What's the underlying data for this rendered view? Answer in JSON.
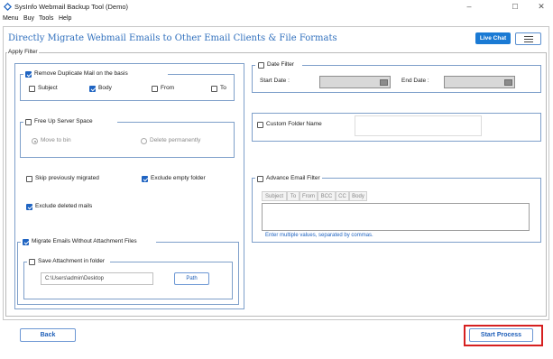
{
  "window": {
    "title": "SysInfo Webmail Backup Tool (Demo)",
    "controls": [
      "–",
      "☐",
      "✕"
    ]
  },
  "menu": [
    "Menu",
    "Buy",
    "Tools",
    "Help"
  ],
  "header": {
    "title": "Directly Migrate Webmail Emails to Other Email Clients & File Formats",
    "live_chat_label": "Live Chat"
  },
  "apply_filter": {
    "legend": "Apply Filter",
    "remove_duplicates": {
      "label": "Remove Duplicate Mail on the basis",
      "checked": true,
      "options": [
        {
          "label": "Subject",
          "checked": false
        },
        {
          "label": "Body",
          "checked": true
        },
        {
          "label": "From",
          "checked": false
        },
        {
          "label": "To",
          "checked": false
        }
      ]
    },
    "free_up": {
      "label": "Free Up Server Space",
      "checked": false,
      "options": [
        {
          "label": "Move to bin",
          "selected": true
        },
        {
          "label": "Delete permanently",
          "selected": false
        }
      ]
    },
    "skip_previously": {
      "label": "Skip previously migrated",
      "checked": false
    },
    "exclude_empty": {
      "label": "Exclude empty folder",
      "checked": true
    },
    "exclude_deleted": {
      "label": "Exclude deleted mails",
      "checked": true
    },
    "migrate_without_attachment": {
      "label": "Migrate Emails Without Attachment Files",
      "checked": true
    },
    "save_attachment": {
      "label": "Save Attachment in folder",
      "checked": false,
      "path_value": "C:\\Users\\admin\\Desktop",
      "path_button": "Path"
    },
    "date_filter": {
      "label": "Date Filter",
      "checked": false,
      "start_label": "Start Date :",
      "end_label": "End Date :"
    },
    "custom_folder": {
      "label": "Custom Folder Name",
      "checked": false,
      "value": ""
    },
    "advance_filter": {
      "label": "Advance Email Filter",
      "checked": false,
      "tabs": [
        "Subject",
        "To",
        "From",
        "BCC",
        "CC",
        "Body"
      ],
      "hint": "Enter multiple values, separated by commas."
    }
  },
  "footer": {
    "back_label": "Back",
    "start_label": "Start Process"
  },
  "colors": {
    "accent": "#1f64c2",
    "title_blue": "#2f6fbd",
    "highlight_red": "#d62020"
  }
}
